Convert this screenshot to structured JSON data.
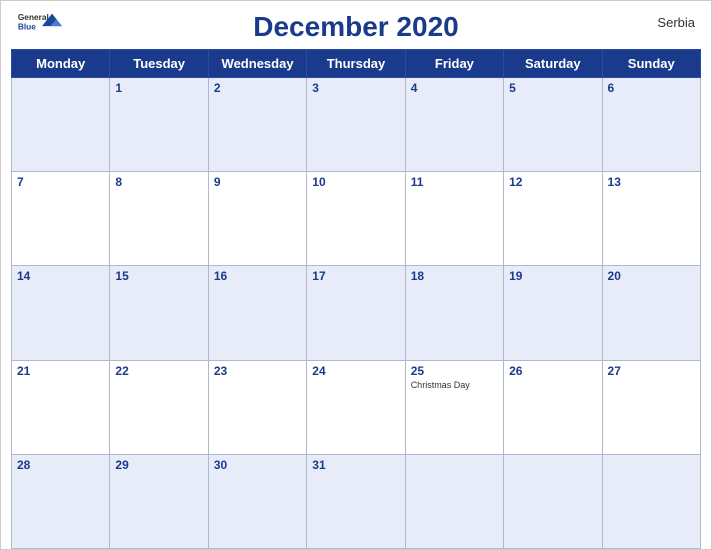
{
  "header": {
    "title": "December 2020",
    "country": "Serbia",
    "logo_general": "General",
    "logo_blue": "Blue"
  },
  "weekdays": [
    "Monday",
    "Tuesday",
    "Wednesday",
    "Thursday",
    "Friday",
    "Saturday",
    "Sunday"
  ],
  "weeks": [
    [
      {
        "num": "",
        "holiday": ""
      },
      {
        "num": "1",
        "holiday": ""
      },
      {
        "num": "2",
        "holiday": ""
      },
      {
        "num": "3",
        "holiday": ""
      },
      {
        "num": "4",
        "holiday": ""
      },
      {
        "num": "5",
        "holiday": ""
      },
      {
        "num": "6",
        "holiday": ""
      }
    ],
    [
      {
        "num": "7",
        "holiday": ""
      },
      {
        "num": "8",
        "holiday": ""
      },
      {
        "num": "9",
        "holiday": ""
      },
      {
        "num": "10",
        "holiday": ""
      },
      {
        "num": "11",
        "holiday": ""
      },
      {
        "num": "12",
        "holiday": ""
      },
      {
        "num": "13",
        "holiday": ""
      }
    ],
    [
      {
        "num": "14",
        "holiday": ""
      },
      {
        "num": "15",
        "holiday": ""
      },
      {
        "num": "16",
        "holiday": ""
      },
      {
        "num": "17",
        "holiday": ""
      },
      {
        "num": "18",
        "holiday": ""
      },
      {
        "num": "19",
        "holiday": ""
      },
      {
        "num": "20",
        "holiday": ""
      }
    ],
    [
      {
        "num": "21",
        "holiday": ""
      },
      {
        "num": "22",
        "holiday": ""
      },
      {
        "num": "23",
        "holiday": ""
      },
      {
        "num": "24",
        "holiday": ""
      },
      {
        "num": "25",
        "holiday": "Christmas Day"
      },
      {
        "num": "26",
        "holiday": ""
      },
      {
        "num": "27",
        "holiday": ""
      }
    ],
    [
      {
        "num": "28",
        "holiday": ""
      },
      {
        "num": "29",
        "holiday": ""
      },
      {
        "num": "30",
        "holiday": ""
      },
      {
        "num": "31",
        "holiday": ""
      },
      {
        "num": "",
        "holiday": ""
      },
      {
        "num": "",
        "holiday": ""
      },
      {
        "num": "",
        "holiday": ""
      }
    ]
  ],
  "colors": {
    "header_bg": "#1a3a8c",
    "accent": "#1a47a0"
  }
}
